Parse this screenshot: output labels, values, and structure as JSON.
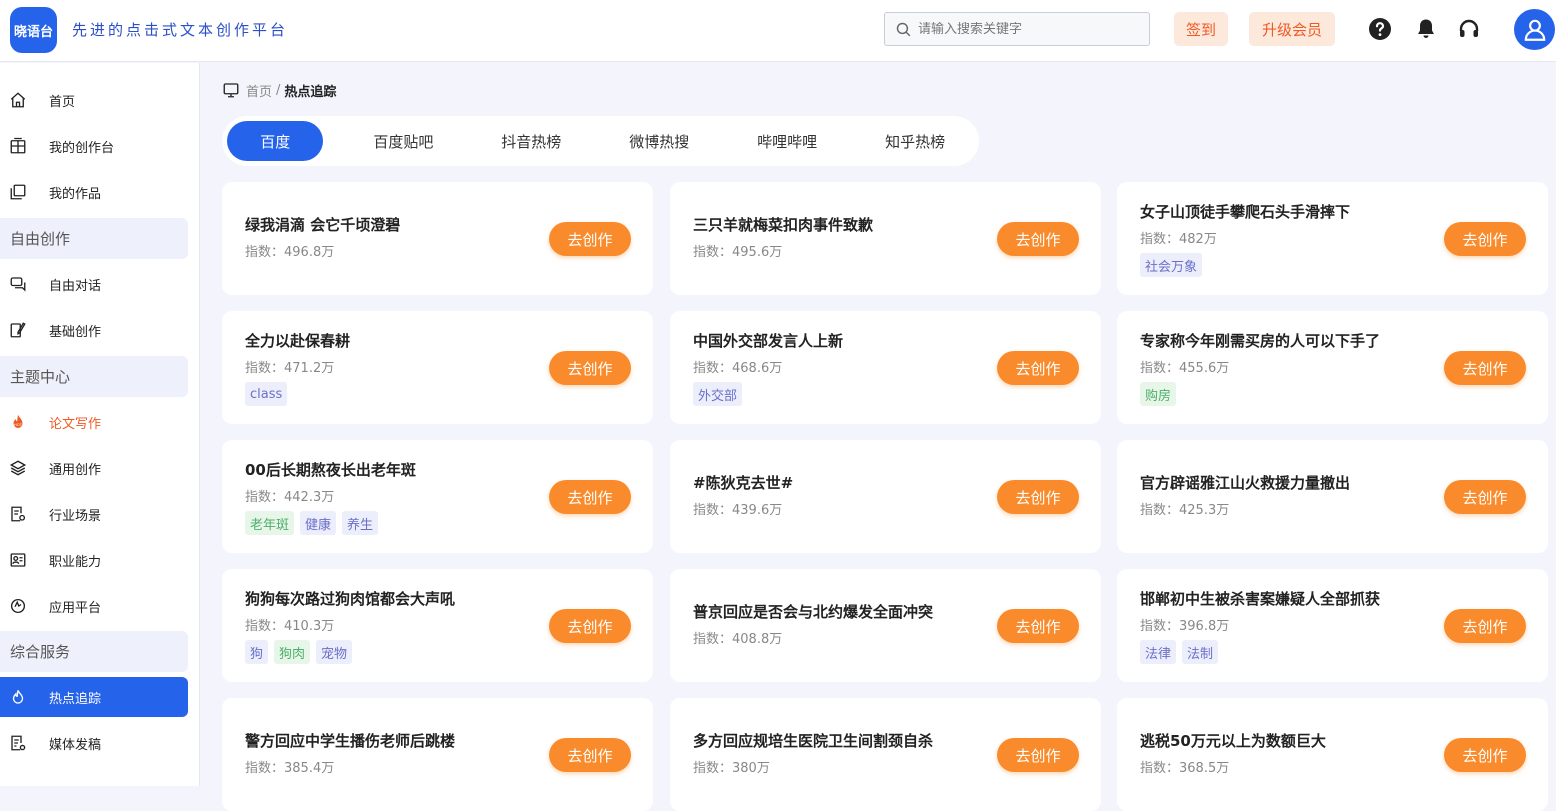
{
  "header": {
    "logo_text": "晓语台",
    "slogan": "先进的点击式文本创作平台",
    "search_placeholder": "请输入搜索关键字",
    "signin_label": "签到",
    "upgrade_label": "升级会员"
  },
  "colors": {
    "primary": "#2563eb",
    "accent": "#f98b2c",
    "hot": "#f05a24"
  },
  "sidebar": {
    "items": [
      {
        "label": "首页",
        "icon": "home-icon"
      },
      {
        "label": "我的创作台",
        "icon": "workspace-icon"
      },
      {
        "label": "我的作品",
        "icon": "works-icon"
      },
      {
        "label": "自由对话",
        "icon": "chat-icon"
      },
      {
        "label": "基础创作",
        "icon": "edit-icon"
      },
      {
        "label": "论文写作",
        "icon": "hot-icon"
      },
      {
        "label": "通用创作",
        "icon": "layers-icon"
      },
      {
        "label": "行业场景",
        "icon": "document-settings-icon"
      },
      {
        "label": "职业能力",
        "icon": "id-card-icon"
      },
      {
        "label": "应用平台",
        "icon": "app-icon"
      },
      {
        "label": "热点追踪",
        "icon": "flame-icon"
      },
      {
        "label": "媒体发稿",
        "icon": "article-icon"
      }
    ],
    "sections": [
      "自由创作",
      "主题中心",
      "综合服务"
    ]
  },
  "breadcrumb": {
    "home": "首页",
    "sep": "/",
    "current": "热点追踪"
  },
  "tabs": [
    "百度",
    "百度贴吧",
    "抖音热榜",
    "微博热搜",
    "哔哩哔哩",
    "知乎热榜"
  ],
  "card_button_label": "去创作",
  "cards": [
    {
      "title": "绿我涓滴 会它千顷澄碧",
      "index": "指数：496.8万",
      "tags": []
    },
    {
      "title": "三只羊就梅菜扣肉事件致歉",
      "index": "指数：495.6万",
      "tags": []
    },
    {
      "title": "女子山顶徒手攀爬石头手滑摔下",
      "index": "指数：482万",
      "tags": [
        {
          "text": "社会万象",
          "color": "purple"
        }
      ]
    },
    {
      "title": "全力以赴保春耕",
      "index": "指数：471.2万",
      "tags": [
        {
          "text": "class",
          "color": "purple"
        }
      ]
    },
    {
      "title": "中国外交部发言人上新",
      "index": "指数：468.6万",
      "tags": [
        {
          "text": "外交部",
          "color": "purple"
        }
      ]
    },
    {
      "title": "专家称今年刚需买房的人可以下手了",
      "index": "指数：455.6万",
      "tags": [
        {
          "text": "购房",
          "color": "green"
        }
      ]
    },
    {
      "title": "00后长期熬夜长出老年斑",
      "index": "指数：442.3万",
      "tags": [
        {
          "text": "老年斑",
          "color": "green"
        },
        {
          "text": "健康",
          "color": "purple"
        },
        {
          "text": "养生",
          "color": "purple"
        }
      ]
    },
    {
      "title": "#陈狄克去世#",
      "index": "指数：439.6万",
      "tags": []
    },
    {
      "title": "官方辟谣雅江山火救援力量撤出",
      "index": "指数：425.3万",
      "tags": []
    },
    {
      "title": "狗狗每次路过狗肉馆都会大声吼",
      "index": "指数：410.3万",
      "tags": [
        {
          "text": "狗",
          "color": "purple"
        },
        {
          "text": "狗肉",
          "color": "green"
        },
        {
          "text": "宠物",
          "color": "purple"
        }
      ]
    },
    {
      "title": "普京回应是否会与北约爆发全面冲突",
      "index": "指数：408.8万",
      "tags": []
    },
    {
      "title": "邯郸初中生被杀害案嫌疑人全部抓获",
      "index": "指数：396.8万",
      "tags": [
        {
          "text": "法律",
          "color": "purple"
        },
        {
          "text": "法制",
          "color": "purple"
        }
      ]
    },
    {
      "title": "警方回应中学生播伤老师后跳楼",
      "index": "指数：385.4万",
      "tags": []
    },
    {
      "title": "多方回应规培生医院卫生间割颈自杀",
      "index": "指数：380万",
      "tags": []
    },
    {
      "title": "逃税50万元以上为数额巨大",
      "index": "指数：368.5万",
      "tags": []
    }
  ]
}
